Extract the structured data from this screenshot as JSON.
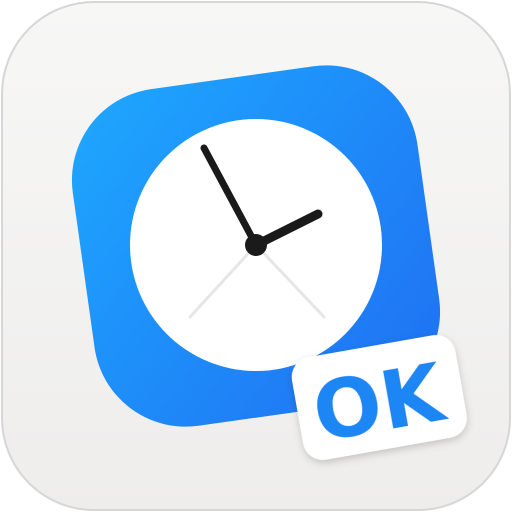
{
  "app_icon": {
    "name": "clock-ok-app-icon",
    "background_color": "#f0efee",
    "tile_gradient": [
      "#1ea8ff",
      "#1f6ff2"
    ],
    "clock_face_color": "#ffffff",
    "hand_color": "#1a1a1a",
    "faint_hand_color": "#e4e4e4",
    "badge": {
      "label": "OK",
      "background_color": "#ffffff",
      "text_color": "#1b86f5"
    }
  }
}
